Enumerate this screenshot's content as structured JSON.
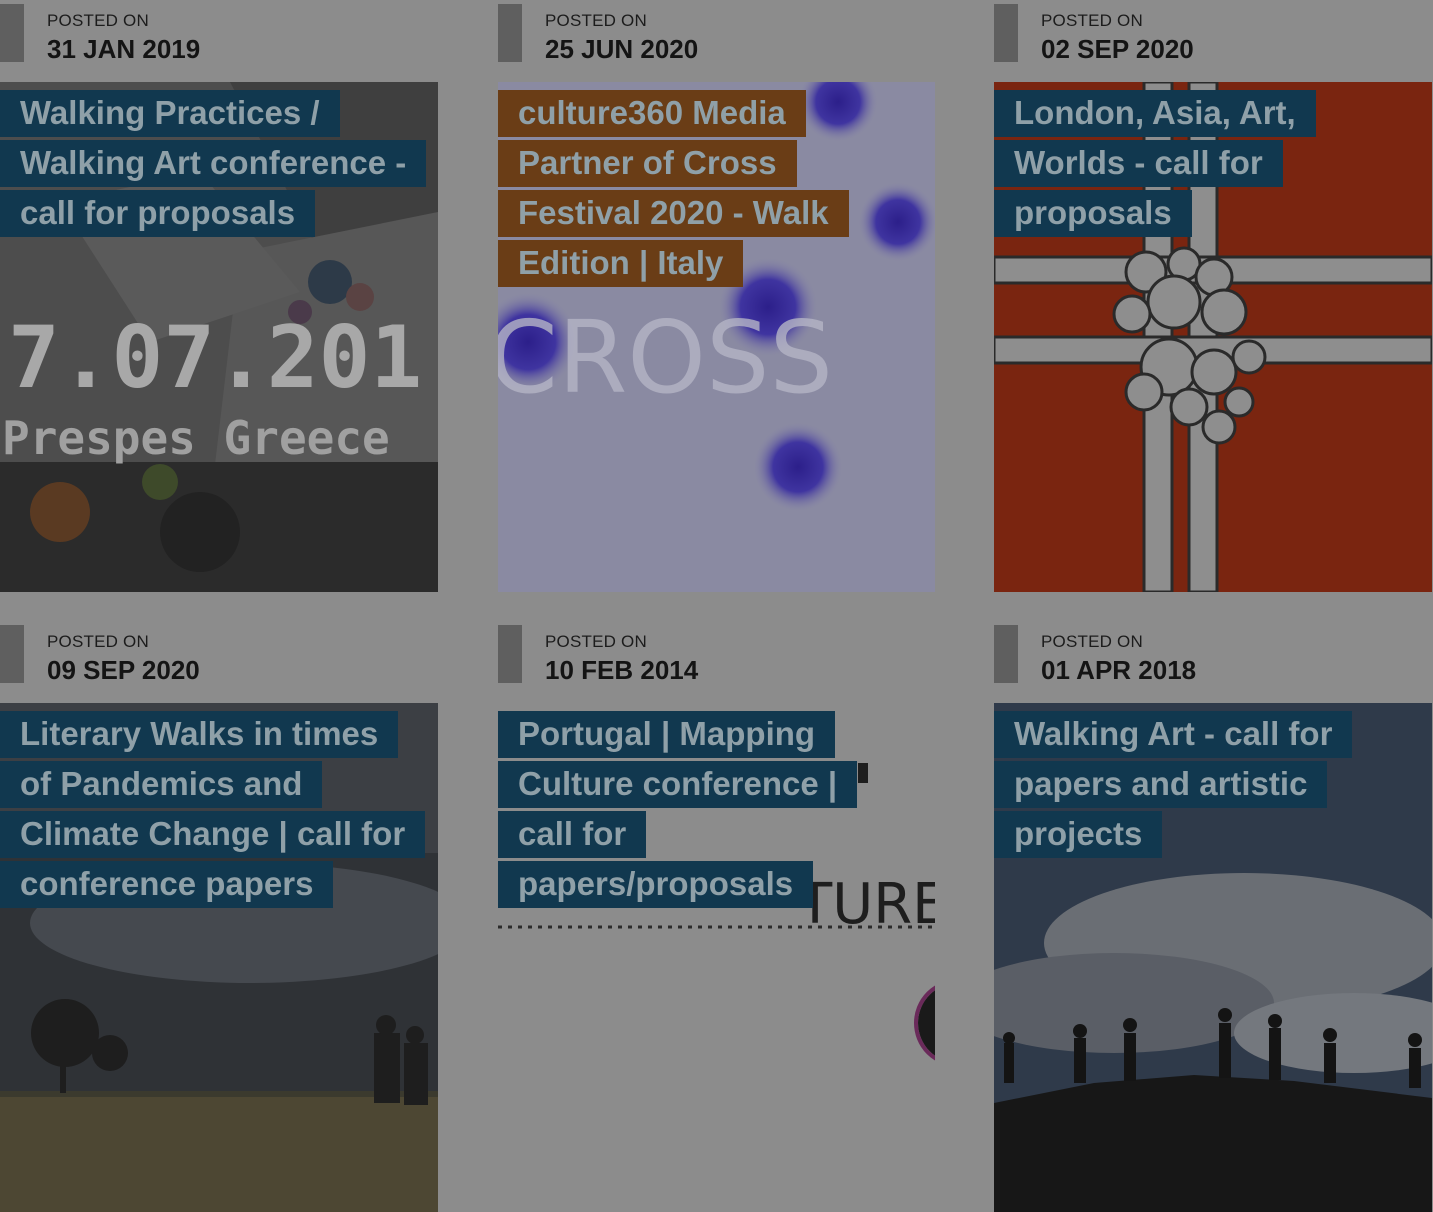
{
  "posts": [
    {
      "label": "POSTED ON",
      "date": "31 JAN 2019",
      "title": "Walking Practices / Walking Art conference - call for proposals",
      "image_text": "7.07.201",
      "image_caption": "Prespes Greece",
      "title_bg": "#11384f"
    },
    {
      "label": "POSTED ON",
      "date": "25 JUN 2020",
      "title": "culture360 Media Partner of Cross Festival 2020 - Walk Edition | Italy",
      "image_text": "CROSS",
      "title_bg": "#6a3d16"
    },
    {
      "label": "POSTED ON",
      "date": "02 SEP 2020",
      "title": "London, Asia, Art, Worlds - call for proposals",
      "title_bg": "#11384f"
    },
    {
      "label": "POSTED ON",
      "date": "09 SEP 2020",
      "title": "Literary Walks in times of Pandemics and Climate Change | call for conference papers",
      "title_bg": "#11384f"
    },
    {
      "label": "POSTED ON",
      "date": "10 FEB 2014",
      "title": "Portugal | Mapping Culture conference | call for papers/proposals",
      "image_text": "TURE",
      "title_bg": "#11384f"
    },
    {
      "label": "POSTED ON",
      "date": "01 APR 2018",
      "title": "Walking Art - call for papers and artistic projects",
      "title_bg": "#11384f"
    }
  ]
}
